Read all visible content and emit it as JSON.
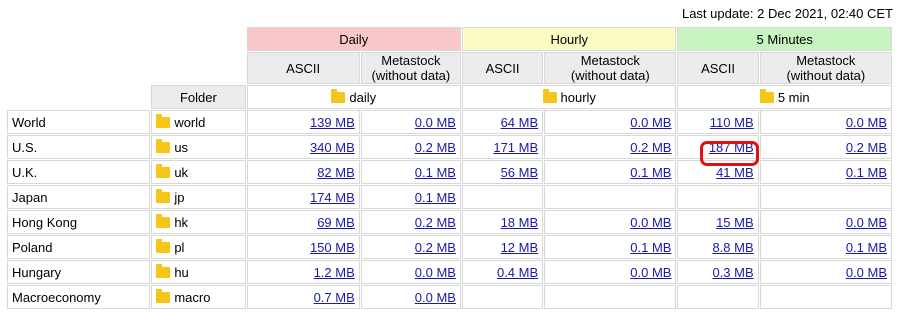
{
  "last_update": "Last update: 2 Dec 2021, 02:40 CET",
  "header": {
    "groups": [
      "Daily",
      "Hourly",
      "5 Minutes"
    ],
    "ascii": "ASCII",
    "metastock_line1": "Metastock",
    "metastock_line2": "(without data)",
    "folder_label": "Folder",
    "folders": [
      "daily",
      "hourly",
      "5 min"
    ]
  },
  "rows": [
    {
      "market": "World",
      "folder": "world",
      "d_ascii": "139 MB",
      "d_meta": "0.0 MB",
      "h_ascii": "64 MB",
      "h_meta": "0.0 MB",
      "m_ascii": "110 MB",
      "m_meta": "0.0 MB"
    },
    {
      "market": "U.S.",
      "folder": "us",
      "d_ascii": "340 MB",
      "d_meta": "0.2 MB",
      "h_ascii": "171 MB",
      "h_meta": "0.2 MB",
      "m_ascii": "187 MB",
      "m_meta": "0.2 MB"
    },
    {
      "market": "U.K.",
      "folder": "uk",
      "d_ascii": "82 MB",
      "d_meta": "0.1 MB",
      "h_ascii": "56 MB",
      "h_meta": "0.1 MB",
      "m_ascii": "41 MB",
      "m_meta": "0.1 MB"
    },
    {
      "market": "Japan",
      "folder": "jp",
      "d_ascii": "174 MB",
      "d_meta": "0.1 MB",
      "h_ascii": "",
      "h_meta": "",
      "m_ascii": "",
      "m_meta": ""
    },
    {
      "market": "Hong Kong",
      "folder": "hk",
      "d_ascii": "69 MB",
      "d_meta": "0.2 MB",
      "h_ascii": "18 MB",
      "h_meta": "0.0 MB",
      "m_ascii": "15 MB",
      "m_meta": "0.0 MB"
    },
    {
      "market": "Poland",
      "folder": "pl",
      "d_ascii": "150 MB",
      "d_meta": "0.2 MB",
      "h_ascii": "12 MB",
      "h_meta": "0.1 MB",
      "m_ascii": "8.8 MB",
      "m_meta": "0.1 MB"
    },
    {
      "market": "Hungary",
      "folder": "hu",
      "d_ascii": "1.2 MB",
      "d_meta": "0.0 MB",
      "h_ascii": "0.4 MB",
      "h_meta": "0.0 MB",
      "m_ascii": "0.3 MB",
      "m_meta": "0.0 MB"
    },
    {
      "market": "Macroeconomy",
      "folder": "macro",
      "d_ascii": "0.7 MB",
      "d_meta": "0.0 MB",
      "h_ascii": "",
      "h_meta": "",
      "m_ascii": "",
      "m_meta": ""
    }
  ],
  "colors": {
    "daily_header": "#f8c8c8",
    "hourly_header": "#fbfbc4",
    "five_min_header": "#c8f4c0",
    "link": "#1a1aa6",
    "highlight": "#e01010",
    "folder_icon": "#f5c518"
  },
  "icons": {
    "folder": "folder-icon"
  }
}
